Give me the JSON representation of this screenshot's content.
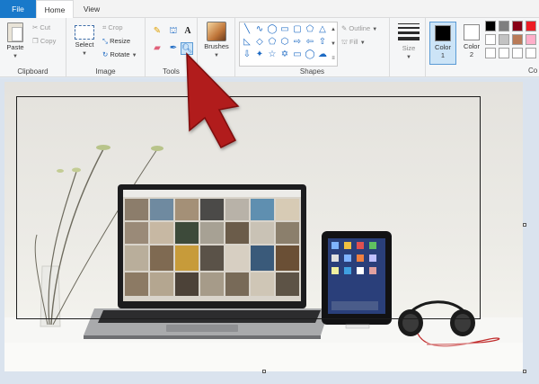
{
  "tabs": {
    "file": "File",
    "home": "Home",
    "view": "View"
  },
  "clipboard": {
    "paste": "Paste",
    "cut": "Cut",
    "copy": "Copy",
    "label": "Clipboard"
  },
  "image": {
    "select": "Select",
    "crop": "Crop",
    "resize": "Resize",
    "rotate": "Rotate",
    "label": "Image"
  },
  "tools": {
    "label": "Tools",
    "active_tool": "magnifier"
  },
  "brushes": {
    "label": "Brushes"
  },
  "shapes": {
    "outline": "Outline",
    "fill": "Fill",
    "label": "Shapes"
  },
  "size": {
    "label": "Size"
  },
  "colors": {
    "color1_label": "Color",
    "color1_num": "1",
    "color1_value": "#000000",
    "color2_label": "Color",
    "color2_num": "2",
    "color2_value": "#ffffff",
    "label_partial": "Co",
    "palette": [
      "#000000",
      "#7f7f7f",
      "#880015",
      "#ed1c24",
      "#ffffff",
      "#c3c3c3",
      "#b97a57",
      "#ffaec9",
      "#ffffff",
      "#ffffff",
      "#ffffff",
      "#ffffff",
      "#ffffff",
      "#ffffff",
      "#ffffff",
      "#ffffff"
    ]
  },
  "overlay": {
    "arrow_color": "#b11a1a"
  }
}
